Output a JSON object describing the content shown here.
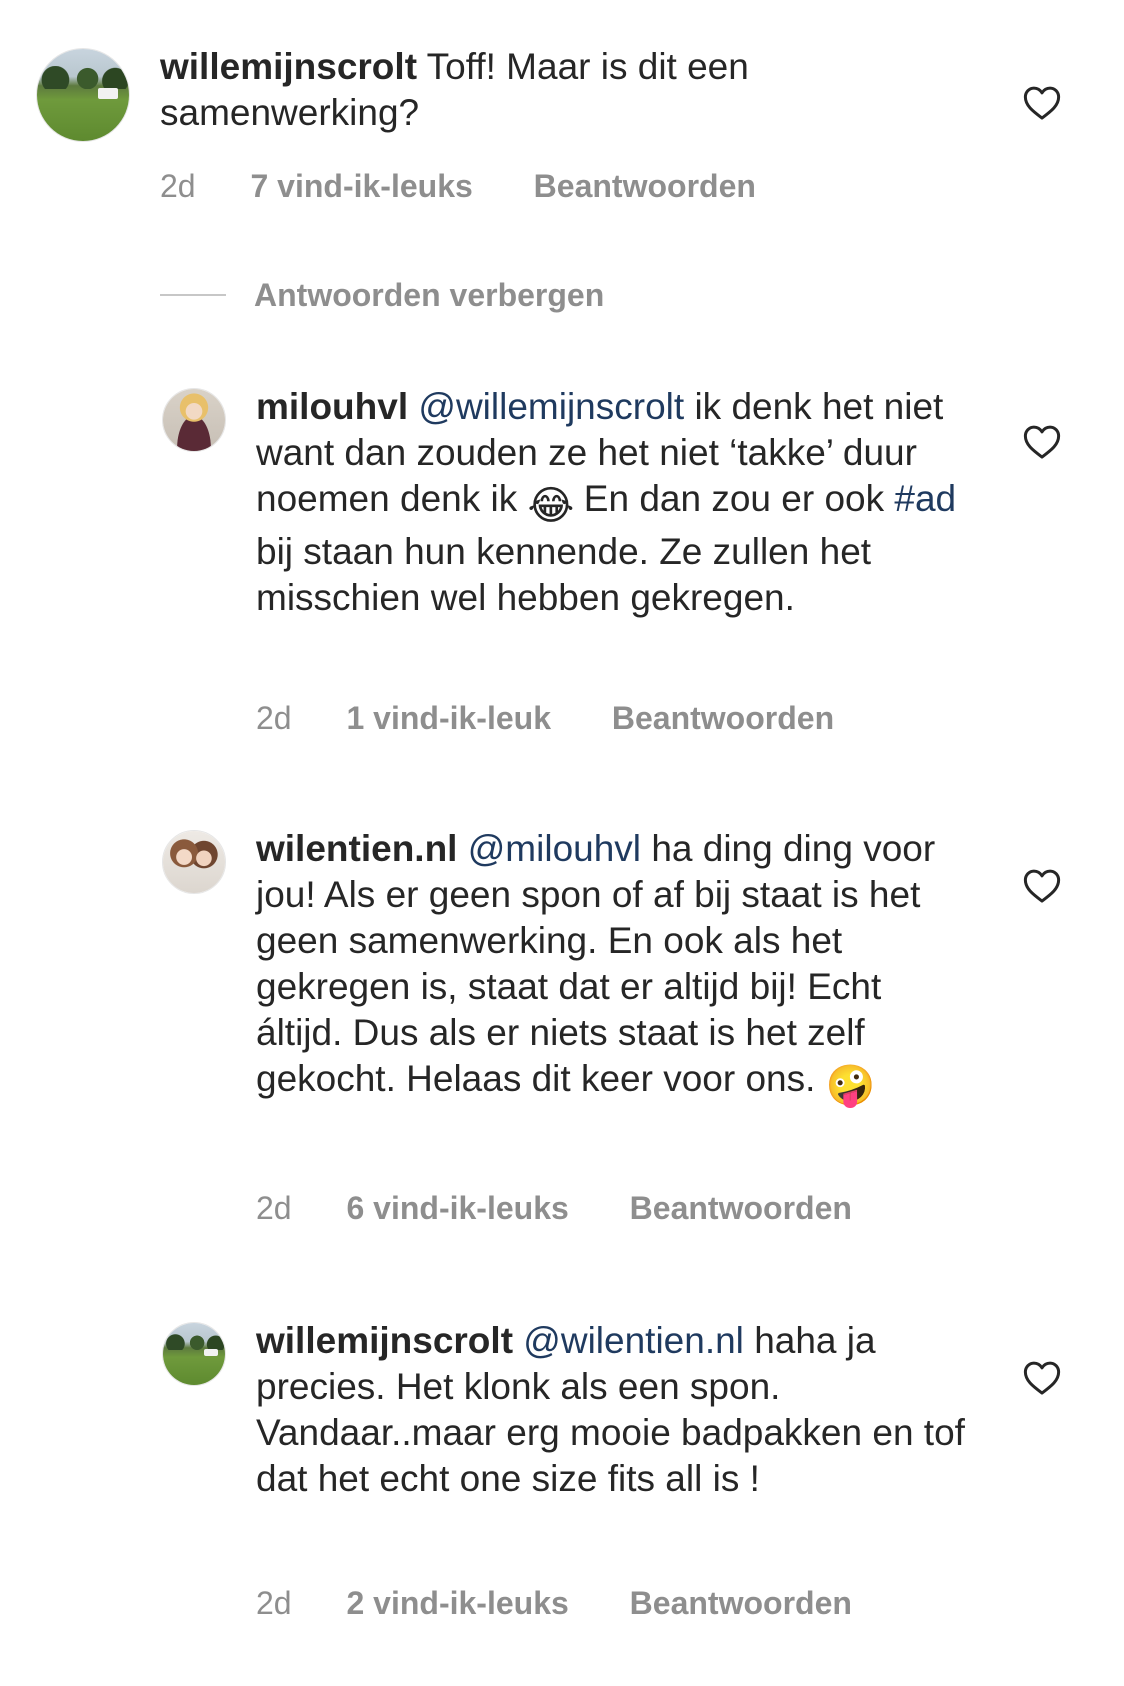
{
  "comments": [
    {
      "username": "willemijnscrolt",
      "mention": "",
      "body": "Toff! Maar is dit een samenwerking?",
      "time": "2d",
      "likes": "7 vind-ik-leuks",
      "reply": "Beantwoorden",
      "avatar_icon": "landscape-avatar-icon"
    }
  ],
  "hide_replies": "Antwoorden verbergen",
  "replies": [
    {
      "username": "milouhvl",
      "mention": "@willemijnscrolt",
      "body_parts": [
        "ik denk het niet want dan zouden ze het niet ‘takke’ duur noemen denk ik ",
        "😂",
        " En dan zou er ook ",
        "#ad",
        " bij staan hun kennende. Ze zullen het misschien wel hebben gekregen."
      ],
      "time": "2d",
      "likes": "1 vind-ik-leuk",
      "reply": "Beantwoorden",
      "avatar_icon": "person-avatar-icon"
    },
    {
      "username": "wilentien.nl",
      "mention": "@milouhvl",
      "body_parts": [
        "ha ding ding voor jou! Als er geen spon of af bij staat is het geen samenwerking. En ook als het gekregen is, staat dat er altijd bij! Echt áltijd. Dus als er niets staat is het zelf gekocht. Helaas dit keer voor ons. ",
        "🤪"
      ],
      "time": "2d",
      "likes": "6 vind-ik-leuks",
      "reply": "Beantwoorden",
      "avatar_icon": "duo-avatar-icon"
    },
    {
      "username": "willemijnscrolt",
      "mention": "@wilentien.nl",
      "body": "haha ja precies. Het klonk als een spon. Vandaar..maar erg mooie badpakken en tof dat het echt one size fits all is !",
      "time": "2d",
      "likes": "2 vind-ik-leuks",
      "reply": "Beantwoorden",
      "avatar_icon": "landscape-avatar-icon"
    }
  ],
  "colors": {
    "text": "#262626",
    "meta": "#8e8e8e",
    "mention": "#1f3a5f",
    "divider": "#c7c7c7"
  },
  "icons": {
    "like": "heart-outline-icon"
  }
}
